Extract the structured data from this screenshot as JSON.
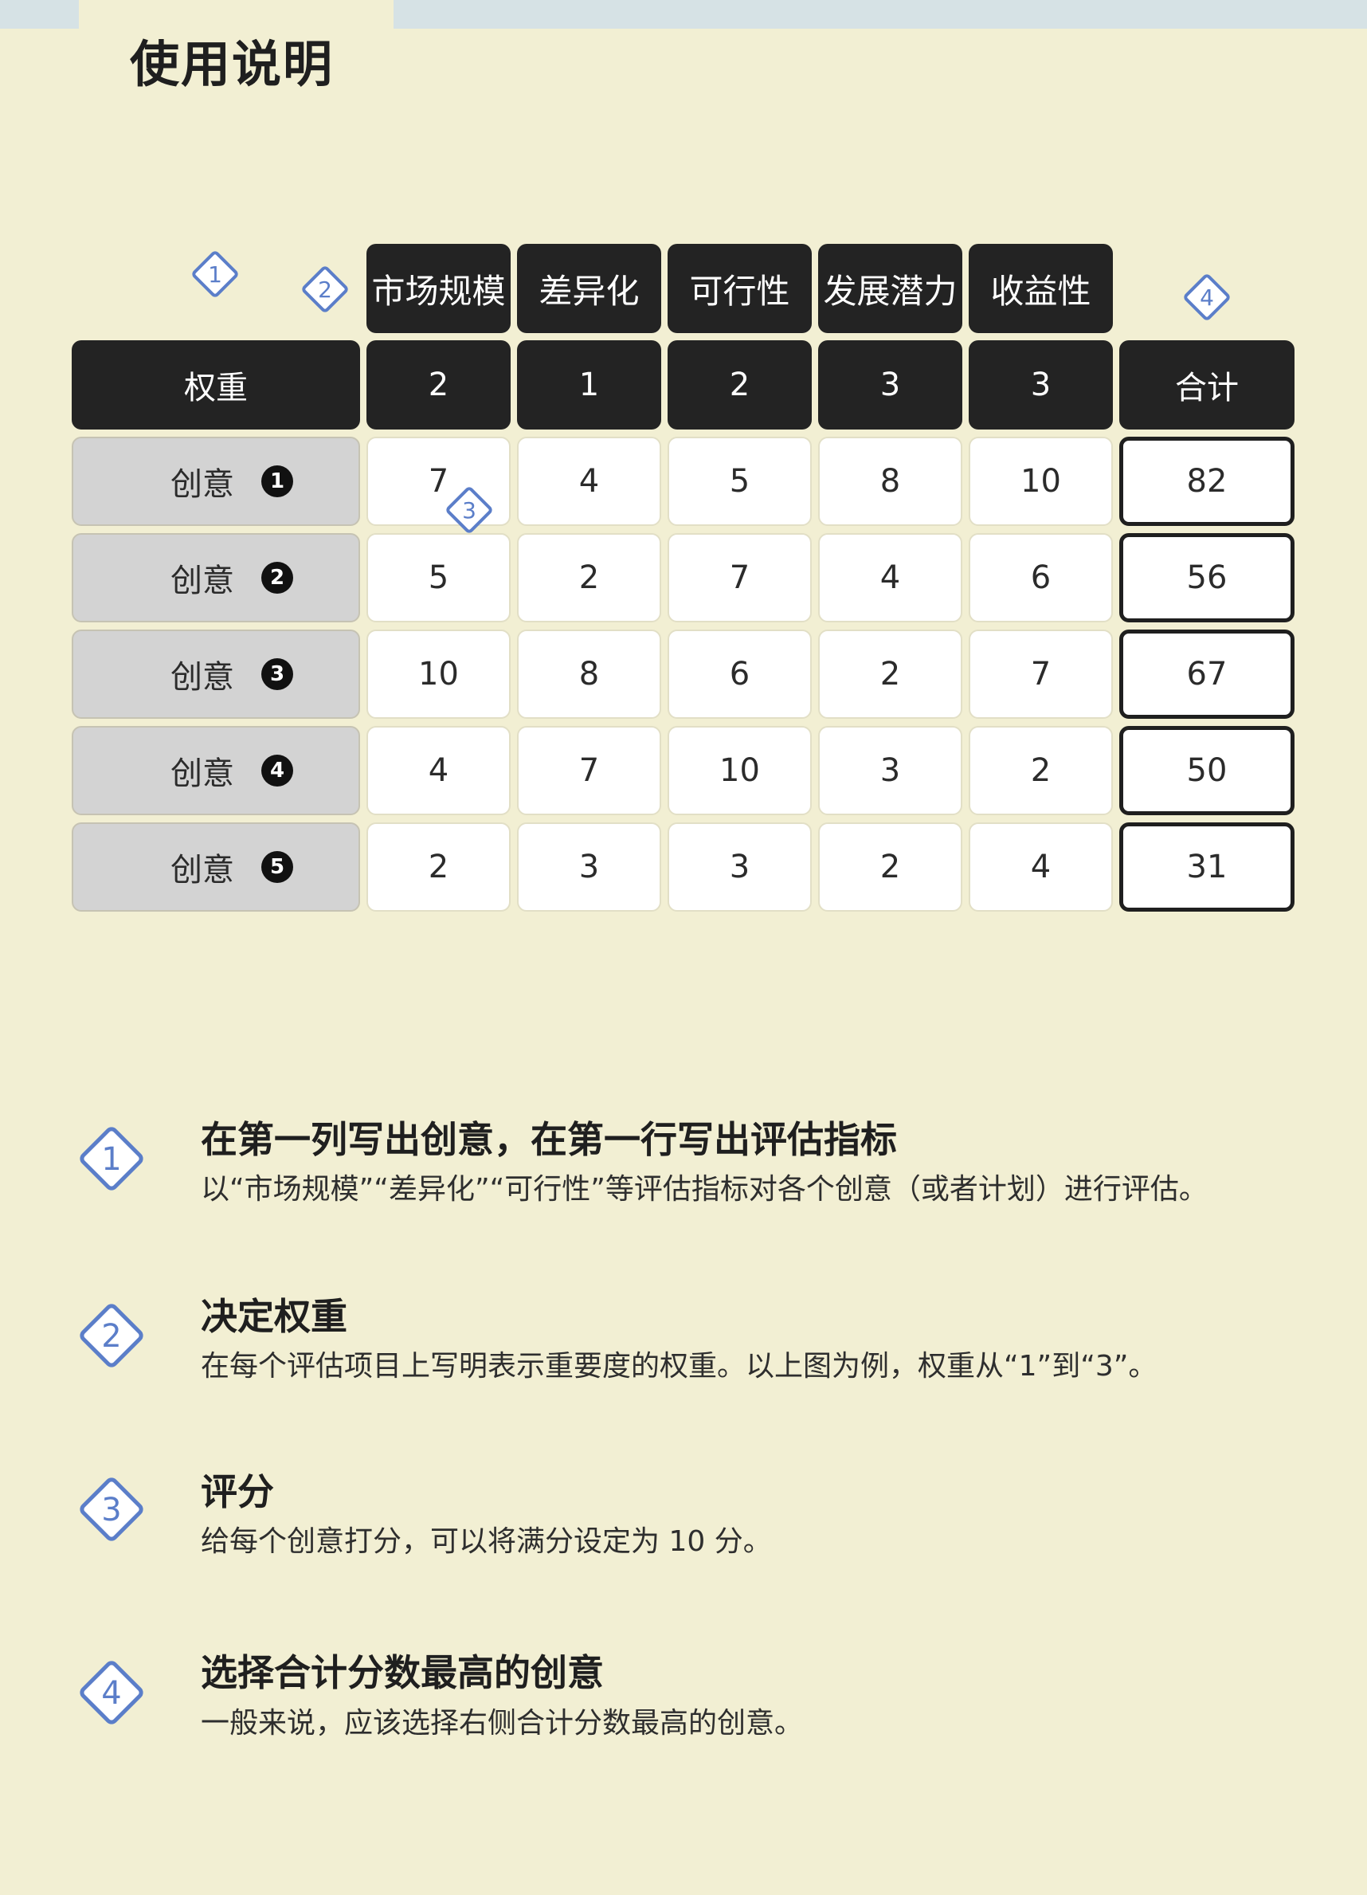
{
  "page": {
    "title": "使用说明"
  },
  "table": {
    "corner_label": "权重",
    "total_label": "合计",
    "criteria": [
      {
        "name": "市场规模",
        "weight": "2"
      },
      {
        "name": "差异化",
        "weight": "1"
      },
      {
        "name": "可行性",
        "weight": "2"
      },
      {
        "name": "发展潜力",
        "weight": "3"
      },
      {
        "name": "收益性",
        "weight": "3"
      }
    ],
    "rows": [
      {
        "label": "创意",
        "number": "1",
        "scores": [
          "7",
          "4",
          "5",
          "8",
          "10"
        ],
        "total": "82"
      },
      {
        "label": "创意",
        "number": "2",
        "scores": [
          "5",
          "2",
          "7",
          "4",
          "6"
        ],
        "total": "56"
      },
      {
        "label": "创意",
        "number": "3",
        "scores": [
          "10",
          "8",
          "6",
          "2",
          "7"
        ],
        "total": "67"
      },
      {
        "label": "创意",
        "number": "4",
        "scores": [
          "4",
          "7",
          "10",
          "3",
          "2"
        ],
        "total": "50"
      },
      {
        "label": "创意",
        "number": "5",
        "scores": [
          "2",
          "3",
          "3",
          "2",
          "4"
        ],
        "total": "31"
      }
    ]
  },
  "markers": {
    "step1": "1",
    "step2": "2",
    "step3": "3",
    "step4": "4"
  },
  "steps": [
    {
      "number": "1",
      "title": "在第一列写出创意，在第一行写出评估指标",
      "description": "以“市场规模”“差异化”“可行性”等评估指标对各个创意（或者计划）进行评估。"
    },
    {
      "number": "2",
      "title": "决定权重",
      "description": "在每个评估项目上写明表示重要度的权重。以上图为例，权重从“1”到“3”。"
    },
    {
      "number": "3",
      "title": "评分",
      "description": "给每个创意打分，可以将满分设定为 10 分。"
    },
    {
      "number": "4",
      "title": "选择合计分数最高的创意",
      "description": "一般来说，应该选择右侧合计分数最高的创意。"
    }
  ],
  "colors": {
    "background": "#f2efd3",
    "header_dark": "#232323",
    "label_gray": "#d3d3d3",
    "marker_blue": "#5b7ec9"
  }
}
